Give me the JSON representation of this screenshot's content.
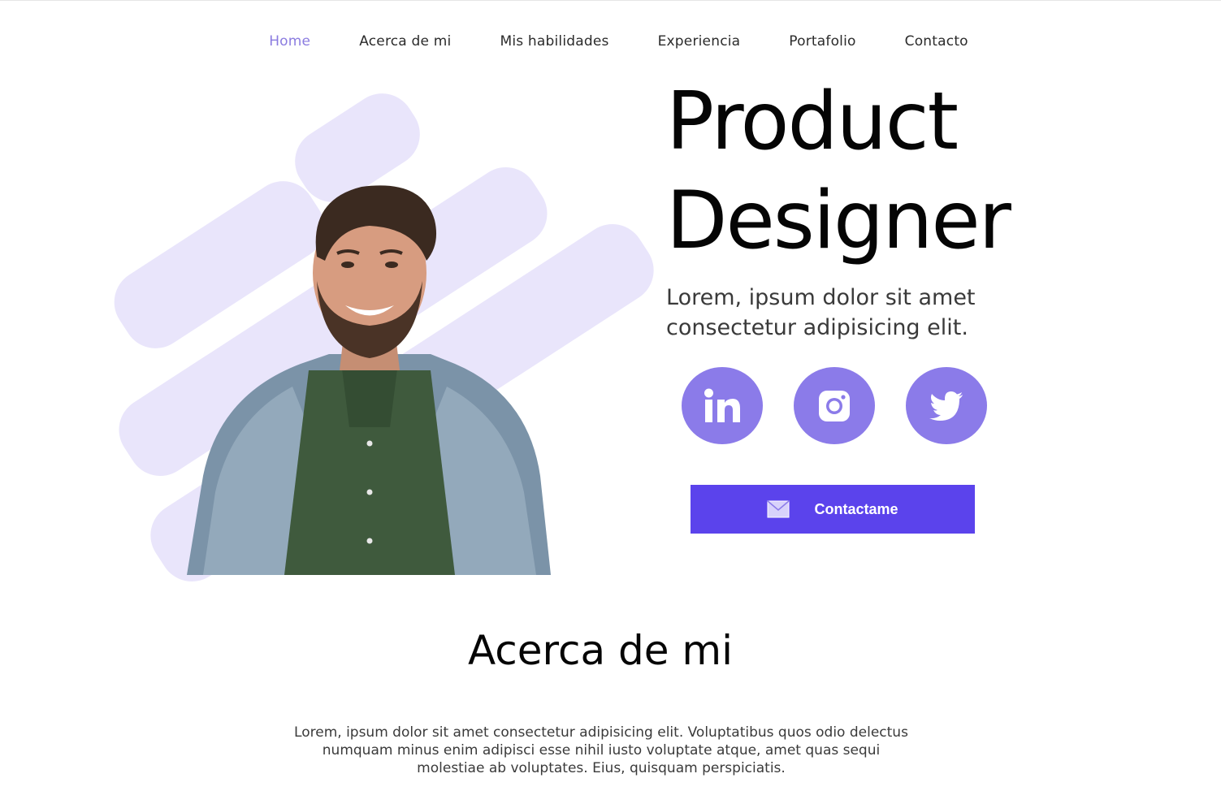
{
  "nav": {
    "items": [
      {
        "label": "Home",
        "active": true
      },
      {
        "label": "Acerca de mi",
        "active": false
      },
      {
        "label": "Mis habilidades",
        "active": false
      },
      {
        "label": "Experiencia",
        "active": false
      },
      {
        "label": "Portafolio",
        "active": false
      },
      {
        "label": "Contacto",
        "active": false
      }
    ]
  },
  "hero": {
    "title_line1": "Product",
    "title_line2": "Designer",
    "subtitle": "Lorem, ipsum dolor sit amet consectetur adipisicing elit.",
    "socials": [
      {
        "icon": "linkedin-icon"
      },
      {
        "icon": "instagram-icon"
      },
      {
        "icon": "twitter-icon"
      }
    ],
    "cta_label": "Contactame",
    "cta_icon": "envelope-icon"
  },
  "about": {
    "title": "Acerca de mi",
    "text": "Lorem, ipsum dolor sit amet consectetur adipisicing elit. Voluptatibus quos odio delectus numquam minus enim adipisci esse nihil iusto voluptate atque, amet quas sequi molestiae ab voluptates. Eius, quisquam perspiciatis."
  },
  "colors": {
    "accent": "#8b7be9",
    "button": "#5b43ec",
    "nav_active": "#8b7ce0",
    "stripes": "#e9e5fb"
  }
}
